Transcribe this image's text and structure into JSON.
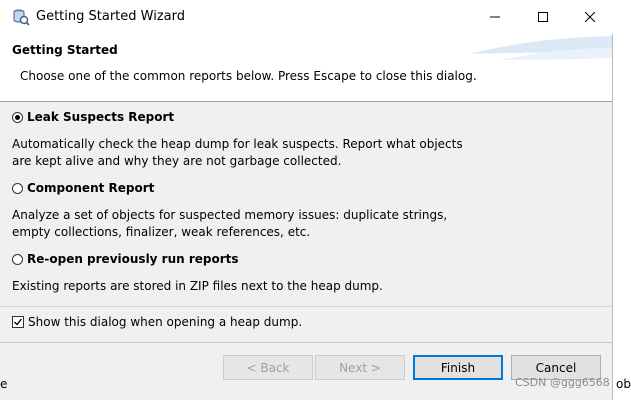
{
  "window": {
    "title": "Getting Started Wizard"
  },
  "header": {
    "title": "Getting Started",
    "description": "Choose one of the common reports below. Press Escape to close this dialog."
  },
  "options": [
    {
      "label": "Leak Suspects Report",
      "selected": true,
      "description": "Automatically check the heap dump for leak suspects. Report what objects are kept alive and why they are not garbage collected."
    },
    {
      "label": "Component Report",
      "selected": false,
      "description": "Analyze a set of objects for suspected memory issues: duplicate strings, empty collections, finalizer, weak references, etc."
    },
    {
      "label": "Re-open previously run reports",
      "selected": false,
      "description": "Existing reports are stored in ZIP files next to the heap dump."
    }
  ],
  "show_dialog": {
    "label": "Show this dialog when opening a heap dump.",
    "checked": true
  },
  "buttons": {
    "back": "< Back",
    "next": "Next >",
    "finish": "Finish",
    "cancel": "Cancel"
  },
  "background": {
    "left_fragment": "e",
    "right_fragment": "ob"
  },
  "watermark": "CSDN @ggg6568",
  "colors": {
    "dialog_bg": "#f0f0f0",
    "default_button_border": "#0078d7",
    "banner_accent": "#dbe9f6"
  }
}
